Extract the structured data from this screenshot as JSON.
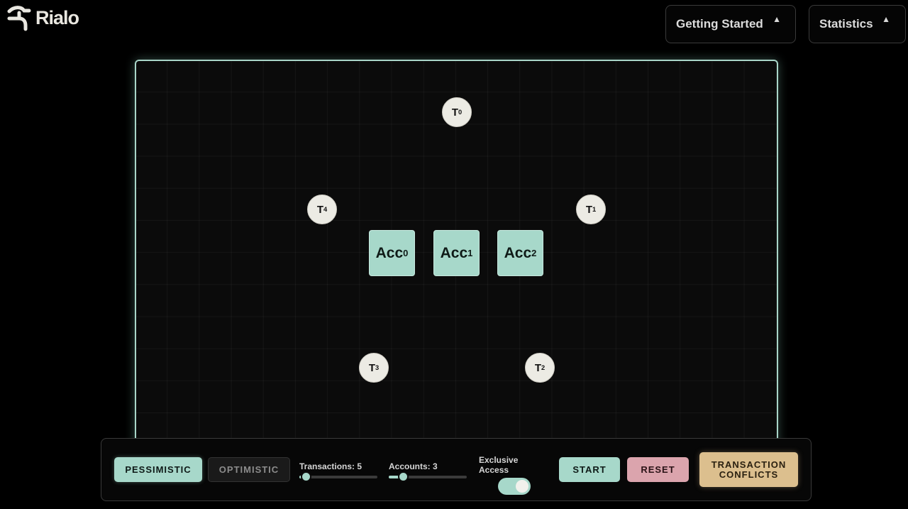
{
  "brand": {
    "name": "Rialo",
    "icon": "rialo-logo-icon"
  },
  "header": {
    "getting_started": {
      "label": "Getting Started",
      "icon": "triangle-up-icon",
      "arrow": "▲"
    },
    "statistics": {
      "label": "Statistics",
      "icon": "triangle-up-icon",
      "arrow": "▲"
    }
  },
  "canvas": {
    "transactions": [
      {
        "base": "T",
        "sub": "0"
      },
      {
        "base": "T",
        "sub": "1"
      },
      {
        "base": "T",
        "sub": "2"
      },
      {
        "base": "T",
        "sub": "3"
      },
      {
        "base": "T",
        "sub": "4"
      }
    ],
    "accounts": [
      {
        "base": "Acc",
        "sub": "0"
      },
      {
        "base": "Acc",
        "sub": "1"
      },
      {
        "base": "Acc",
        "sub": "2"
      }
    ]
  },
  "controls": {
    "pessimistic_label": "PESSIMISTIC",
    "optimistic_label": "OPTIMISTIC",
    "mode_selected": "PESSIMISTIC",
    "transactions_label": "Transactions: 5",
    "transactions_value": 5,
    "transactions_fill": 0.08,
    "accounts_label": "Accounts: 3",
    "accounts_value": 3,
    "accounts_fill": 0.18,
    "exclusive_access_label": "Exclusive Access",
    "exclusive_access_on": true,
    "start_label": "START",
    "reset_label": "RESET",
    "conflicts_line1": "TRANSACTION",
    "conflicts_line2": "CONFLICTS"
  },
  "colors": {
    "accent": "#a7d8ca",
    "reset": "#dba4ad",
    "conflicts": "#dcbf8e",
    "background": "#000000"
  }
}
